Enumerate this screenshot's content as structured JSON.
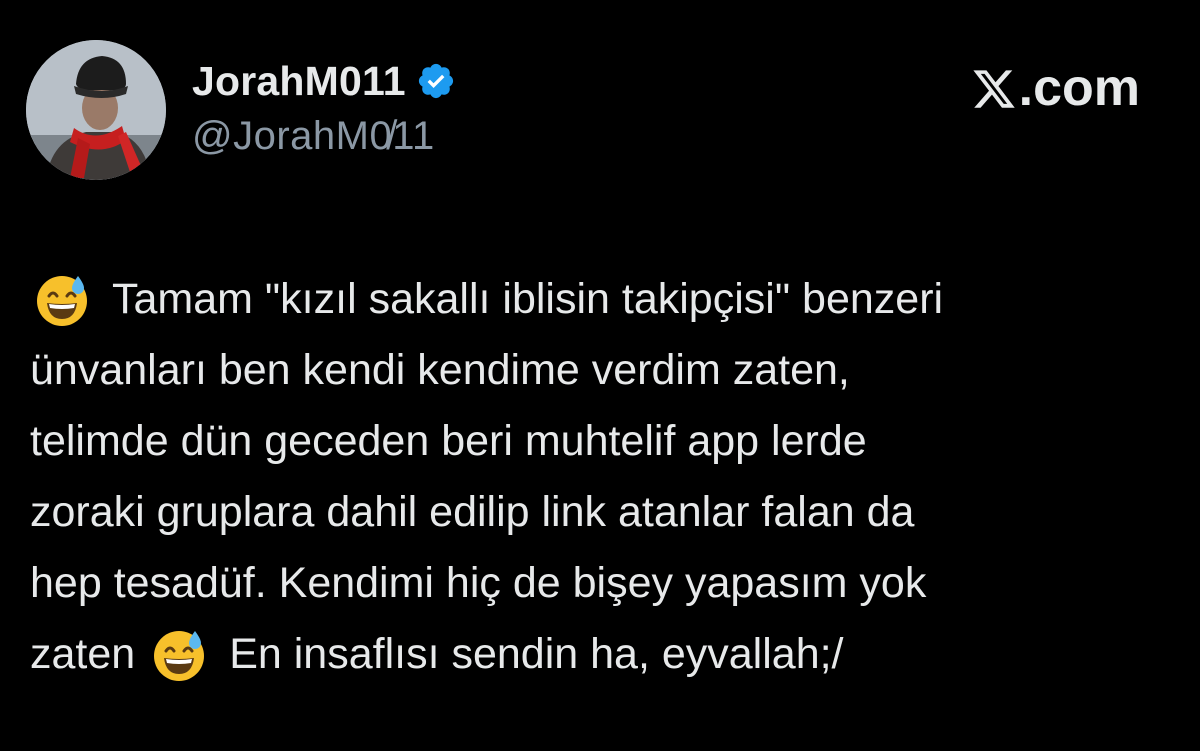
{
  "author": {
    "display_name": "JorahM011",
    "handle": "@JorahM0̸11",
    "verified": true,
    "avatar_icon": "avatar-man-fur-hat-red-scarf"
  },
  "brand": {
    "label": ".com",
    "logo_icon": "x-logo-icon"
  },
  "tweet": {
    "lines": [
      "Tamam \"kızıl sakallı iblisin takipçisi\" benzeri",
      "ünvanları ben kendi kendime verdim zaten,",
      "telimde dün geceden beri muhtelif app lerde",
      "zoraki gruplara dahil edilip link atanlar falan da",
      "hep tesadüf. Kendimi hiç de bişey yapasım yok",
      "zaten",
      "En insaflısı sendin ha, eyvallah;/"
    ],
    "emoji": "grinning-face-with-sweat-emoji"
  },
  "colors": {
    "background": "#000000",
    "text": "#e7e9ea",
    "secondary_text": "#8b98a5",
    "verified_blue": "#1d9bf0"
  }
}
